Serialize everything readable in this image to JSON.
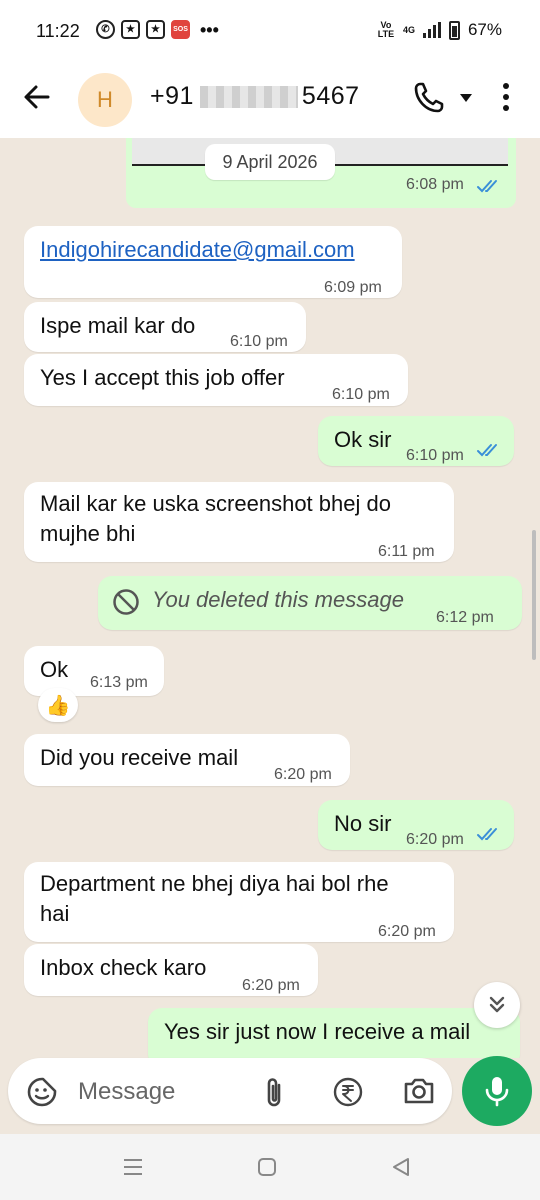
{
  "status_bar": {
    "time": "11:22",
    "sos_label": "SOS",
    "volte_label": "Vo LTE",
    "network_label": "4G",
    "battery": "67%"
  },
  "header": {
    "avatar_letter": "H",
    "contact_prefix": "+91",
    "contact_suffix": "5467",
    "icons": [
      "back-arrow-icon",
      "phone-icon",
      "dropdown-caret-icon",
      "more-vertical-icon"
    ]
  },
  "chat": {
    "date_separator": "9 April 2026",
    "messages": [
      {
        "id": "m0",
        "direction": "out",
        "text": "",
        "time": "6:08 pm",
        "read": true
      },
      {
        "id": "m1",
        "direction": "in",
        "text": "Indigohirecandidate@gmail.com",
        "time": "6:09 pm",
        "is_link": true
      },
      {
        "id": "m2",
        "direction": "in",
        "text": "Ispe mail kar do",
        "time": "6:10 pm"
      },
      {
        "id": "m3",
        "direction": "in",
        "text": "Yes I accept this job offer",
        "time": "6:10 pm"
      },
      {
        "id": "m4",
        "direction": "out",
        "text": "Ok sir",
        "time": "6:10 pm",
        "read": true
      },
      {
        "id": "m5",
        "direction": "in",
        "text_line1": "Mail kar ke uska screenshot bhej do",
        "text_line2": "mujhe bhi",
        "time": "6:11 pm"
      },
      {
        "id": "m6",
        "direction": "out",
        "text": "You deleted this message",
        "time": "6:12 pm",
        "deleted": true
      },
      {
        "id": "m7",
        "direction": "in",
        "text": "Ok",
        "time": "6:13 pm",
        "reaction": "👍"
      },
      {
        "id": "m8",
        "direction": "in",
        "text": "Did you receive mail",
        "time": "6:20 pm"
      },
      {
        "id": "m9",
        "direction": "out",
        "text": "No sir",
        "time": "6:20 pm",
        "read": true
      },
      {
        "id": "m10",
        "direction": "in",
        "text_line1": "Department ne bhej diya hai bol rhe",
        "text_line2": "hai",
        "time": "6:20 pm"
      },
      {
        "id": "m11",
        "direction": "in",
        "text": "Inbox check karo",
        "time": "6:20 pm"
      },
      {
        "id": "m12",
        "direction": "out",
        "text": "Yes sir just now I receive a mail"
      }
    ]
  },
  "composer": {
    "placeholder": "Message",
    "icons": [
      "sticker-icon",
      "paperclip-icon",
      "rupee-payment-icon",
      "camera-icon",
      "microphone-icon"
    ]
  },
  "colors": {
    "chat_background": "#efe7dd",
    "incoming_bubble": "#ffffff",
    "outgoing_bubble": "#d9fdd3",
    "read_tick": "#3a8fd8",
    "mic_button": "#1daa61",
    "link": "#1e62c2"
  }
}
